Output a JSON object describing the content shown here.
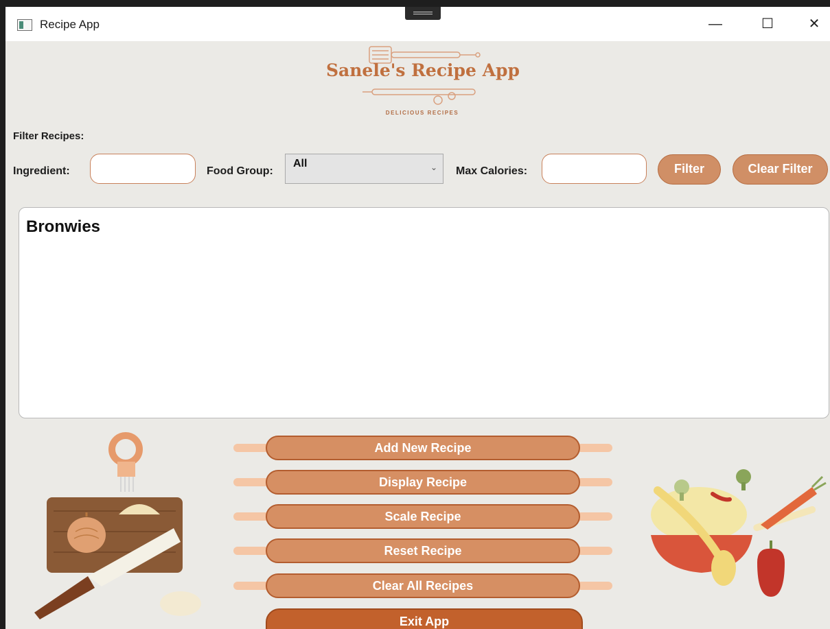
{
  "window": {
    "title": "Recipe App"
  },
  "titlebar": {
    "minimize": "—",
    "maximize": "☐",
    "close": "✕"
  },
  "header": {
    "title": "Sanele's Recipe App",
    "subtitle": "DELICIOUS RECIPES"
  },
  "filter": {
    "section_label": "Filter Recipes:",
    "ingredient_label": "Ingredient:",
    "ingredient_value": "",
    "food_group_label": "Food Group:",
    "food_group_selected": "All",
    "max_calories_label": "Max Calories:",
    "max_calories_value": "",
    "filter_button": "Filter",
    "clear_filter_button": "Clear Filter"
  },
  "recipes": {
    "items": [
      "Bronwies"
    ]
  },
  "actions": {
    "add": "Add New Recipe",
    "display": "Display Recipe",
    "scale": "Scale Recipe",
    "reset": "Reset Recipe",
    "clear_all": "Clear All Recipes",
    "exit": "Exit App"
  },
  "colors": {
    "accent": "#d08f66",
    "accent_border": "#b56b40",
    "exit": "#c2612c",
    "background": "#ebeae6"
  },
  "icons": {
    "app": "window-icon",
    "left_illustration": "cutting-board-onion-knife-icon",
    "right_illustration": "pan-vegetables-icon",
    "logo": "rolling-pin-logo-icon"
  }
}
